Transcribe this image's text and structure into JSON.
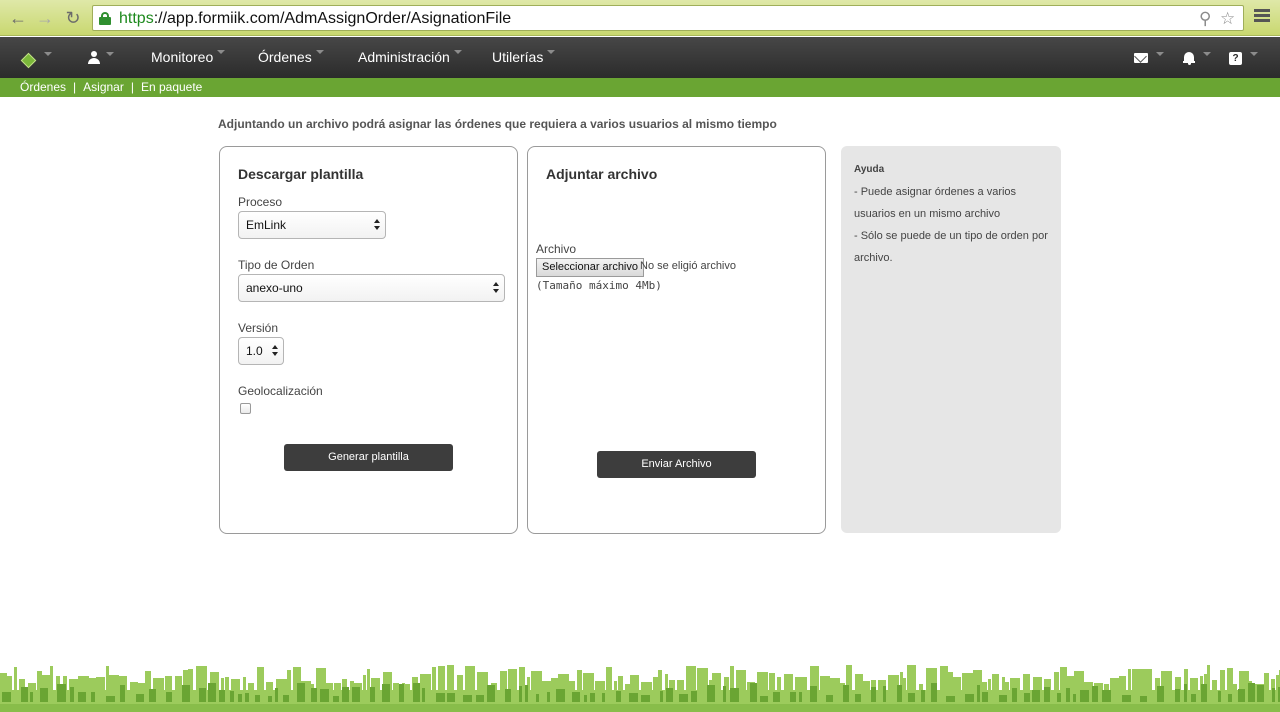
{
  "browser": {
    "url_scheme": "https",
    "url_rest": "://app.formiik.com/AdmAssignOrder/AsignationFile",
    "back_icon": "back-arrow-icon",
    "forward_icon": "forward-arrow-icon",
    "reload_icon": "reload-icon"
  },
  "topbar": {
    "menu": [
      {
        "label": "Monitoreo"
      },
      {
        "label": "Órdenes"
      },
      {
        "label": "Administración"
      },
      {
        "label": "Utilerías"
      }
    ],
    "help_glyph": "?"
  },
  "subnav": {
    "items": [
      "Órdenes",
      "Asignar",
      "En paquete"
    ],
    "separator": "|"
  },
  "main": {
    "intro": "Adjuntando un archivo podrá asignar las órdenes que requiera a varios usuarios al mismo tiempo",
    "download": {
      "title": "Descargar plantilla",
      "process_label": "Proceso",
      "process_value": "EmLink",
      "order_type_label": "Tipo de Orden",
      "order_type_value": "anexo-uno",
      "version_label": "Versión",
      "version_value": "1.0",
      "geo_label": "Geolocalización",
      "geo_checked": false,
      "generate_button": "Generar plantilla"
    },
    "attach": {
      "title": "Adjuntar archivo",
      "file_label": "Archivo",
      "file_button": "Seleccionar archivo",
      "file_status": "No se eligió archivo",
      "file_hint": "(Tamaño máximo 4Mb)",
      "submit_button": "Enviar Archivo"
    },
    "help": {
      "title": "Ayuda",
      "lines": [
        "- Puede asignar órdenes a varios",
        "usuarios en un mismo archivo",
        "- Sólo se puede de un tipo de orden por",
        "archivo."
      ]
    }
  },
  "colors": {
    "chrome": "#c9d870",
    "topbar": "#2b2b2b",
    "subnav": "#6aa533",
    "button": "#3d3d3d",
    "help_bg": "#e6e6e6",
    "skyline_light": "#9ccb5c",
    "skyline_dark": "#6aa533"
  }
}
